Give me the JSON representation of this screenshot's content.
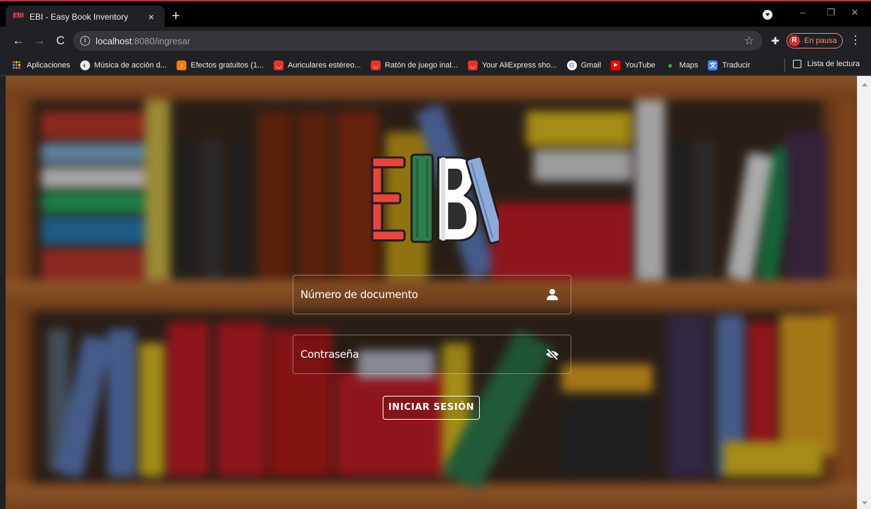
{
  "browser": {
    "tab_title": "EBI - Easy Book Inventory",
    "tab_favicon": "EBI",
    "tab_close": "×",
    "new_tab": "+",
    "url_host": "localhost",
    "url_path": ":8080/ingresar",
    "profile_initial": "R",
    "profile_status": "En pausa",
    "window_controls": [
      "–",
      "❐",
      "✕"
    ],
    "bookmarks": [
      {
        "label": "Aplicaciones",
        "icon": "apps-grid-icon",
        "color": "#ea4335"
      },
      {
        "label": "Música de acción d...",
        "icon": "globe-icon",
        "color": "#5f6368"
      },
      {
        "label": "Efectos gratuitos (1...",
        "icon": "music-icon",
        "color": "#f57c00"
      },
      {
        "label": "Auriculares estéreo...",
        "icon": "aliexpress-icon",
        "color": "#e43225"
      },
      {
        "label": "Ratón de juego inal...",
        "icon": "aliexpress-icon",
        "color": "#e43225"
      },
      {
        "label": "Your AliExpress sho...",
        "icon": "aliexpress-icon",
        "color": "#e43225"
      },
      {
        "label": "Gmail",
        "icon": "google-icon",
        "color": "#ffffff"
      },
      {
        "label": "YouTube",
        "icon": "youtube-icon",
        "color": "#ff0000"
      },
      {
        "label": "Maps",
        "icon": "maps-icon",
        "color": "#34a853"
      },
      {
        "label": "Traducir",
        "icon": "translate-icon",
        "color": "#4285f4"
      }
    ],
    "reading_list": "Lista de lectura"
  },
  "login": {
    "document_placeholder": "Número de documento",
    "password_placeholder": "Contraseña",
    "submit_label": "INICIAR SESIÓN",
    "logo_colors": {
      "e_book": "#e8453c",
      "green_book": "#2e7d4f",
      "b_book": "#ffffff",
      "slant_book": "#8ea9d8"
    }
  }
}
